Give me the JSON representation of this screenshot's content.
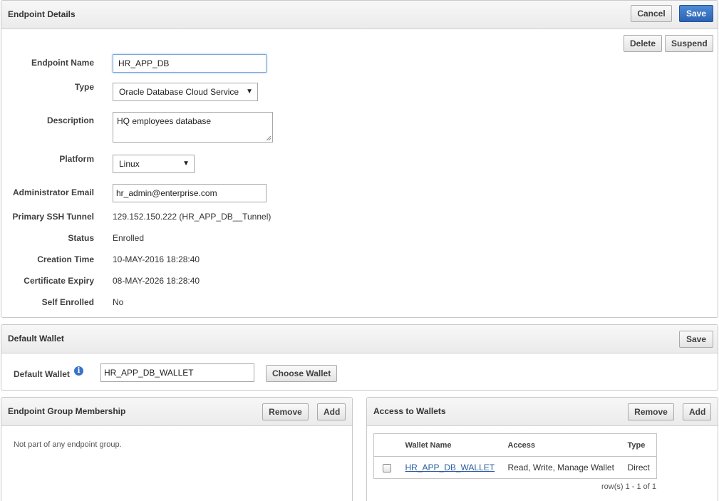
{
  "endpoint_details": {
    "title": "Endpoint Details",
    "cancel_label": "Cancel",
    "save_label": "Save",
    "delete_label": "Delete",
    "suspend_label": "Suspend",
    "fields": {
      "endpoint_name_label": "Endpoint Name",
      "endpoint_name_value": "HR_APP_DB",
      "type_label": "Type",
      "type_value": "Oracle Database Cloud Service",
      "description_label": "Description",
      "description_value": "HQ employees database",
      "platform_label": "Platform",
      "platform_value": "Linux",
      "admin_email_label": "Administrator Email",
      "admin_email_value": "hr_admin@enterprise.com",
      "ssh_tunnel_label": "Primary SSH Tunnel",
      "ssh_tunnel_value": "129.152.150.222 (HR_APP_DB__Tunnel)",
      "status_label": "Status",
      "status_value": "Enrolled",
      "creation_time_label": "Creation Time",
      "creation_time_value": "10-MAY-2016 18:28:40",
      "cert_expiry_label": "Certificate Expiry",
      "cert_expiry_value": "08-MAY-2026 18:28:40",
      "self_enrolled_label": "Self Enrolled",
      "self_enrolled_value": "No"
    }
  },
  "default_wallet": {
    "title": "Default Wallet",
    "save_label": "Save",
    "label": "Default Wallet",
    "value": "HR_APP_DB_WALLET",
    "choose_label": "Choose Wallet",
    "info_glyph": "i"
  },
  "group_membership": {
    "title": "Endpoint Group Membership",
    "remove_label": "Remove",
    "add_label": "Add",
    "empty_text": "Not part of any endpoint group."
  },
  "wallet_access": {
    "title": "Access to Wallets",
    "remove_label": "Remove",
    "add_label": "Add",
    "columns": {
      "wallet_name": "Wallet Name",
      "access": "Access",
      "type": "Type"
    },
    "rows": [
      {
        "wallet_name": "HR_APP_DB_WALLET",
        "access": "Read, Write, Manage Wallet",
        "type": "Direct"
      }
    ],
    "pagination": "row(s) 1 - 1 of 1"
  },
  "icons": {
    "dropdown": "chevron-down-icon",
    "info": "info-icon",
    "resize": "resize-grip-icon"
  },
  "colors": {
    "primary_button": "#2b63b3",
    "link": "#2b5d9c",
    "header_bg": "#ebebeb",
    "border": "#c9c9c9"
  }
}
